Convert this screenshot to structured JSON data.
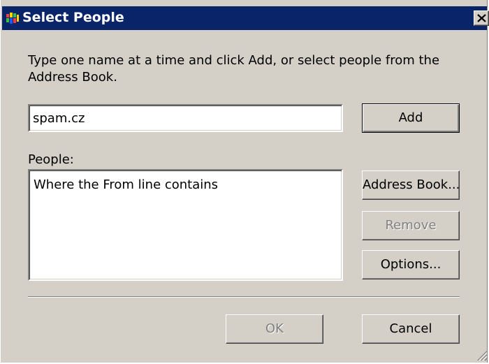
{
  "window": {
    "title": "Select People",
    "close_glyph": "×",
    "icon": "people-app-icon"
  },
  "instructions": "Type one name at a time and click Add, or select people from the Address Book.",
  "name_input": {
    "value": "spam.cz"
  },
  "people": {
    "label": "People:",
    "items": [
      "Where the From line contains"
    ]
  },
  "buttons": {
    "add": "Add",
    "address_book": "Address Book...",
    "remove": "Remove",
    "options": "Options...",
    "ok": "OK",
    "cancel": "Cancel"
  },
  "colors": {
    "titlebar": "#0a246a",
    "dialog_face": "#d4d0c8",
    "disabled_text": "#808080"
  }
}
